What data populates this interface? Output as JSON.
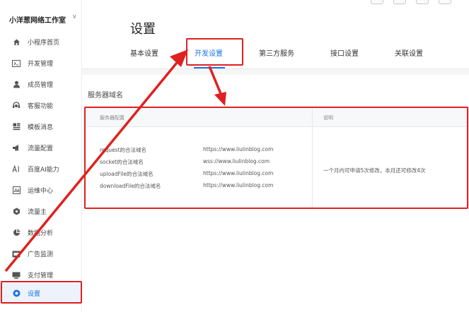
{
  "app": {
    "name": "小洋葱网络工作室"
  },
  "sidebar": {
    "items": [
      {
        "label": "小程序首页",
        "icon": "home-icon"
      },
      {
        "label": "开发管理",
        "icon": "code-icon"
      },
      {
        "label": "成员管理",
        "icon": "user-icon"
      },
      {
        "label": "客服功能",
        "icon": "headset-icon"
      },
      {
        "label": "模板消息",
        "icon": "template-icon"
      },
      {
        "label": "流量配置",
        "icon": "megaphone-icon"
      },
      {
        "label": "百度AI能力",
        "icon": "ai-icon"
      },
      {
        "label": "运维中心",
        "icon": "monitor-icon"
      },
      {
        "label": "流量主",
        "icon": "hexagon-icon"
      },
      {
        "label": "数据分析",
        "icon": "pie-chart-icon"
      },
      {
        "label": "广告监测",
        "icon": "ad-icon"
      },
      {
        "label": "支付管理",
        "icon": "payment-icon"
      },
      {
        "label": "设置",
        "icon": "settings-icon",
        "active": true
      }
    ]
  },
  "main": {
    "title": "设置",
    "tabs": [
      {
        "label": "基本设置"
      },
      {
        "label": "开发设置",
        "active": true
      },
      {
        "label": "第三方服务"
      },
      {
        "label": "接口设置"
      },
      {
        "label": "关联设置"
      }
    ],
    "section_title": "服务器域名",
    "table": {
      "headers": {
        "config": "服务器配置",
        "note": "说明"
      },
      "rows": [
        {
          "label": "request的合法域名",
          "value": "https://www.liulinblog.com"
        },
        {
          "label": "socket的合法域名",
          "value": "wss://www.liulinblog.com"
        },
        {
          "label": "uploadFile的合法域名",
          "value": "https://www.liulinblog.com"
        },
        {
          "label": "downloadFile的合法域名",
          "value": "https://www.liulinblog.com"
        }
      ],
      "note": "一个月内可申请5次修改，本月还可修改4次"
    }
  },
  "colors": {
    "accent": "#1a73e8",
    "annotation": "#e02020"
  }
}
